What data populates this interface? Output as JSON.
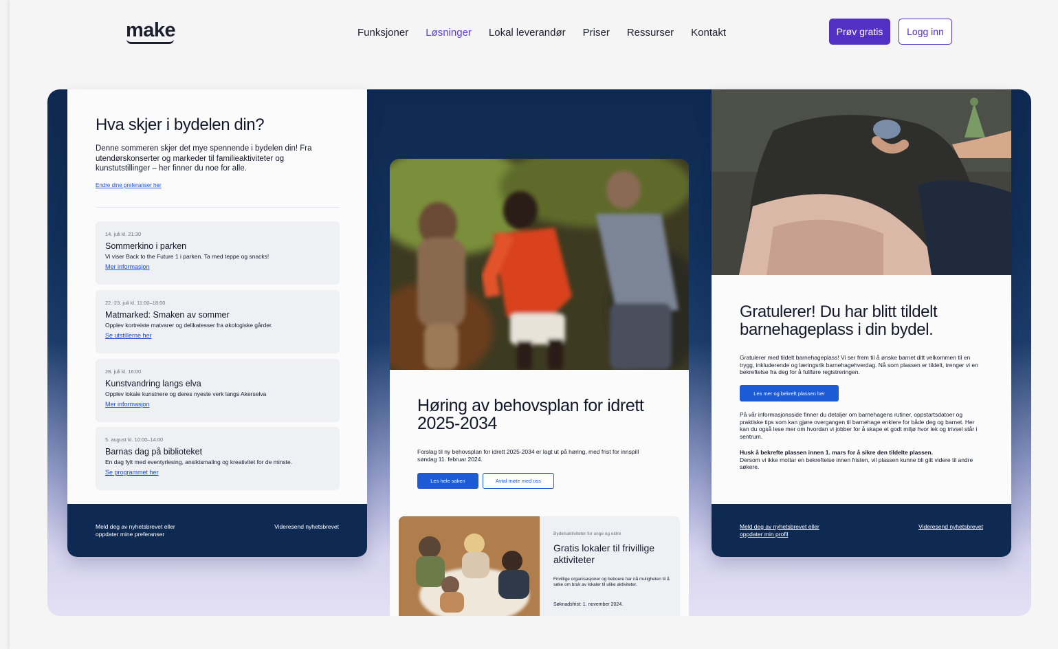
{
  "header": {
    "logo": "make",
    "nav": [
      {
        "label": "Funksjoner"
      },
      {
        "label": "Løsninger"
      },
      {
        "label": "Lokal leverandør"
      },
      {
        "label": "Priser"
      },
      {
        "label": "Ressurser"
      },
      {
        "label": "Kontakt"
      }
    ],
    "active_nav": "Løsninger",
    "try_label": "Prøv gratis",
    "login_label": "Logg inn"
  },
  "left_card": {
    "title": "Hva skjer i bydelen din?",
    "intro": "Denne sommeren skjer det mye spennende i bydelen din! Fra utendørskonserter og markeder til familieaktiviteter og kunstutstillinger – her finner du noe for alle.",
    "pref_link": "Endre dine preferanser her",
    "events": [
      {
        "date": "14. juli kl. 21:30",
        "title": "Sommerkino i parken",
        "desc": "Vi viser Back to the Future 1 i parken. Ta med teppe og snacks!",
        "link": "Mer informasjon"
      },
      {
        "date": "22.-23. juli kl. 11:00–18:00",
        "title": "Matmarked: Smaken av sommer",
        "desc": "Opplev kortreiste matvarer og delikatesser fra økologiske gårder.",
        "link": "Se utstillerne her"
      },
      {
        "date": "28. juli kl. 16:00",
        "title": "Kunstvandring langs elva",
        "desc": "Opplev lokale kunstnere og deres nyeste verk langs Akerselva",
        "link": "Mer informasjon"
      },
      {
        "date": "5. august kl. 10:00–14:00",
        "title": "Barnas dag på biblioteket",
        "desc": "En dag fylt med eventyrlesing, ansiktsmaling og kreativitet for de minste.",
        "link": "Se programmet her"
      }
    ],
    "footer_left": "Meld deg av nyhetsbrevet eller oppdater mine preferanser",
    "footer_right": "Videresend nyhetsbrevet"
  },
  "mid_card": {
    "title": "Høring av behovsplan for idrett 2025-2034",
    "text": "Forslag til ny behovsplan for idrett 2025-2034 er lagt ut på høring, med frist for innspill søndag 11. februar 2024.",
    "primary_button": "Les hele saken",
    "secondary_button": "Avtal møte med oss",
    "sub": {
      "tag": "Bydelsaktiviteter for unge og eldre",
      "title": "Gratis lokaler til frivillige aktiviteter",
      "desc": "Frivillige organisasjoner og beboere har nå muligheten til å søke om bruk av lokaler til ulike aktiviteter.",
      "deadline": "Søknadsfrist: 1. november 2024."
    }
  },
  "right_card": {
    "title": "Gratulerer! Du har blitt tildelt barnehageplass i din bydel.",
    "p1": "Gratulerer med tildelt barnehageplass! Vi ser frem til å ønske barnet ditt velkommen til en trygg, inkluderende og læringsrik barnehagehverdag. Nå som plassen er tildelt, trenger vi en bekreftelse fra deg for å fullføre registreringen.",
    "button": "Les mer og bekreft plassen her",
    "p2": "På vår informasjonsside finner du detaljer om barnehagens rutiner, oppstartsdatoer og praktiske tips som kan gjøre overgangen til barnehage enklere for både deg og barnet. Her kan du også lese mer om hvordan vi jobber for å skape et godt miljø hvor lek og trivsel står i sentrum.",
    "p3_bold": "Husk å bekrefte plassen innen 1. mars for å sikre den tildelte plassen.",
    "p3": "Dersom vi ikke mottar en bekreftelse innen fristen, vil plassen kunne bli gitt videre til andre søkere.",
    "footer_left": "Meld deg av nyhetsbrevet eller oppdater min profil",
    "footer_right": "Videresend nyhetsbrevet"
  },
  "colors": {
    "brand": "#5230c6",
    "navy": "#0f2a52",
    "link": "#1d5ad6"
  }
}
